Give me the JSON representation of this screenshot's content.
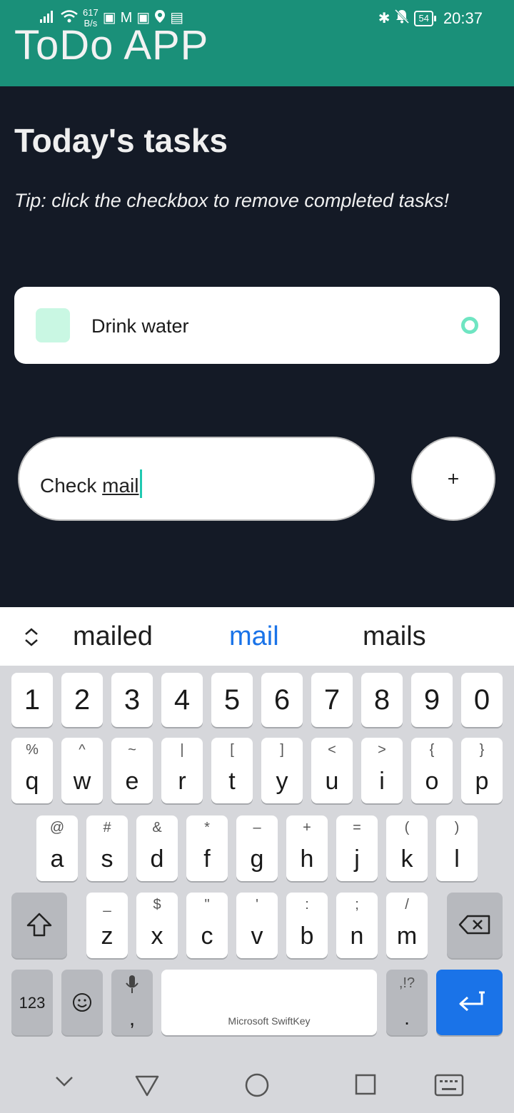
{
  "status_bar": {
    "speed_value": "617",
    "speed_unit": "B/s",
    "battery": "54",
    "time": "20:37"
  },
  "app": {
    "title": "ToDo APP"
  },
  "main": {
    "heading": "Today's tasks",
    "tip": "Tip: click the checkbox to remove completed tasks!",
    "tasks": [
      {
        "label": "Drink water"
      }
    ],
    "input": {
      "value_prefix": "Check ",
      "value_word": "mail"
    },
    "add_label": "+"
  },
  "keyboard": {
    "suggestions": [
      "mailed",
      "mail",
      "mails"
    ],
    "number_row": [
      "1",
      "2",
      "3",
      "4",
      "5",
      "6",
      "7",
      "8",
      "9",
      "0"
    ],
    "row1": [
      {
        "main": "q",
        "alt": "%"
      },
      {
        "main": "w",
        "alt": "^"
      },
      {
        "main": "e",
        "alt": "~"
      },
      {
        "main": "r",
        "alt": "|"
      },
      {
        "main": "t",
        "alt": "["
      },
      {
        "main": "y",
        "alt": "]"
      },
      {
        "main": "u",
        "alt": "<"
      },
      {
        "main": "i",
        "alt": ">"
      },
      {
        "main": "o",
        "alt": "{"
      },
      {
        "main": "p",
        "alt": "}"
      }
    ],
    "row2": [
      {
        "main": "a",
        "alt": "@"
      },
      {
        "main": "s",
        "alt": "#"
      },
      {
        "main": "d",
        "alt": "&"
      },
      {
        "main": "f",
        "alt": "*"
      },
      {
        "main": "g",
        "alt": "–"
      },
      {
        "main": "h",
        "alt": "+"
      },
      {
        "main": "j",
        "alt": "="
      },
      {
        "main": "k",
        "alt": "("
      },
      {
        "main": "l",
        "alt": ")"
      }
    ],
    "row3": [
      {
        "main": "z",
        "alt": "_"
      },
      {
        "main": "x",
        "alt": "$"
      },
      {
        "main": "c",
        "alt": "\""
      },
      {
        "main": "v",
        "alt": "'"
      },
      {
        "main": "b",
        "alt": ":"
      },
      {
        "main": "n",
        "alt": ";"
      },
      {
        "main": "m",
        "alt": "/"
      }
    ],
    "numbers_label": "123",
    "comma": ",",
    "space_label": "Microsoft SwiftKey",
    "punct_top": ",!?",
    "punct_main": "."
  },
  "colors": {
    "app_bar": "#1a9079",
    "background": "#141a26",
    "accent": "#6fe5c2",
    "suggestion_active": "#1a73e8"
  }
}
